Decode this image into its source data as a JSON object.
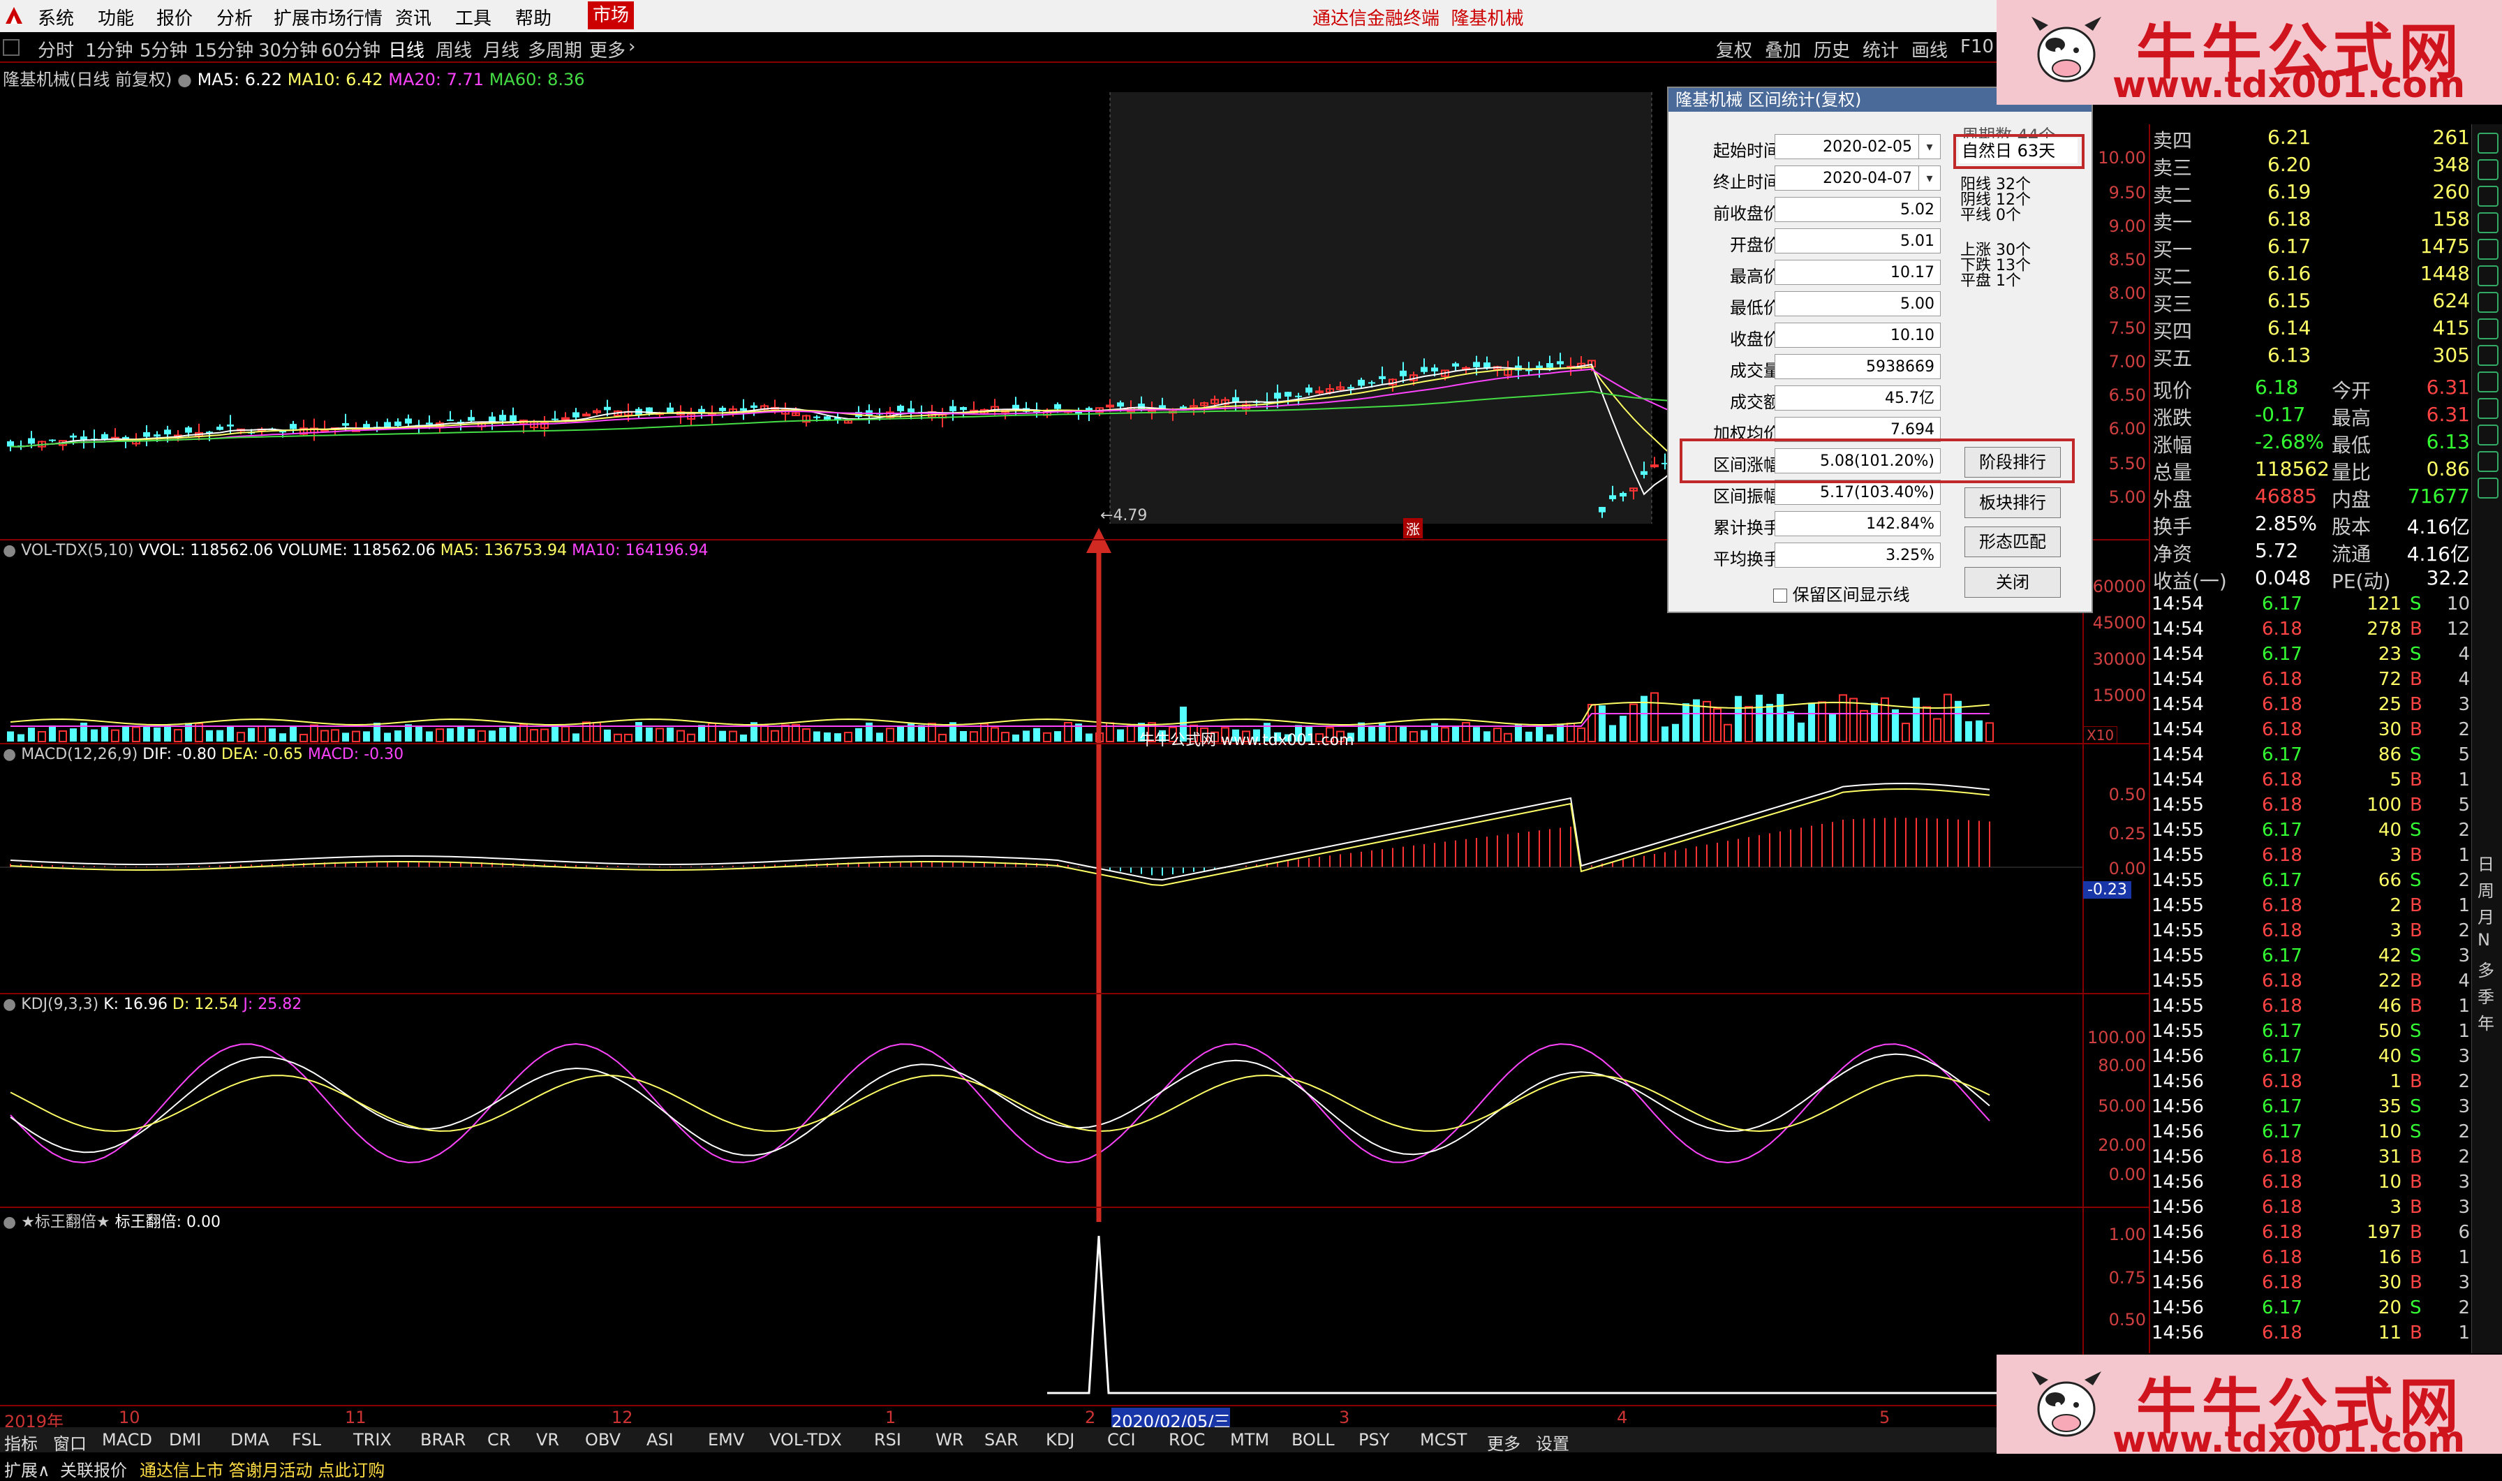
{
  "menubar": {
    "items": [
      "系统",
      "功能",
      "报价",
      "分析",
      "扩展市场行情",
      "资讯",
      "工具",
      "帮助"
    ],
    "market_tab": "市场",
    "title": "通达信金融终端",
    "stock": "隆基机械"
  },
  "periods": [
    "分时",
    "1分钟",
    "5分钟",
    "15分钟",
    "30分钟",
    "60分钟",
    "日线",
    "周线",
    "月线",
    "多周期",
    "更多"
  ],
  "selected_period": "日线",
  "right_buttons": [
    "复权",
    "叠加",
    "历史",
    "统计",
    "画线",
    "F10"
  ],
  "main_panel": {
    "title": "隆基机械(日线 前复权)",
    "ma_labels": [
      {
        "text": "MA5: 6.22",
        "color": "#ffffff"
      },
      {
        "text": "MA10: 6.42",
        "color": "#ffff66"
      },
      {
        "text": "MA20: 7.71",
        "color": "#ff44ff"
      },
      {
        "text": "MA60: 8.36",
        "color": "#44dd44"
      }
    ],
    "y_ticks": [
      "10.00",
      "9.50",
      "9.00",
      "8.50",
      "8.00",
      "7.50",
      "7.00",
      "6.50",
      "6.00",
      "5.50",
      "5.00"
    ],
    "low_marker": "4.79",
    "zhang_label": "涨"
  },
  "vol_panel": {
    "title": "VOL-TDX(5,10)",
    "labels": [
      {
        "text": "VVOL: 118562.06",
        "color": "#ffffff"
      },
      {
        "text": "VOLUME: 118562.06",
        "color": "#ffffff"
      },
      {
        "text": "MA5: 136753.94",
        "color": "#ffff66"
      },
      {
        "text": "MA10: 164196.94",
        "color": "#ff44ff"
      }
    ],
    "y_ticks": [
      "60000",
      "45000",
      "30000",
      "15000"
    ],
    "unit": "X10"
  },
  "macd_panel": {
    "title": "MACD(12,26,9)",
    "labels": [
      {
        "text": "DIF: -0.80",
        "color": "#ffffff"
      },
      {
        "text": "DEA: -0.65",
        "color": "#ffff66"
      },
      {
        "text": "MACD: -0.30",
        "color": "#ff44ff"
      }
    ],
    "y_ticks": [
      "0.50",
      "0.25",
      "0.00"
    ],
    "current": "-0.23"
  },
  "kdj_panel": {
    "title": "KDJ(9,3,3)",
    "labels": [
      {
        "text": "K: 16.96",
        "color": "#ffffff"
      },
      {
        "text": "D: 12.54",
        "color": "#ffff66"
      },
      {
        "text": "J: 25.82",
        "color": "#ff44ff"
      }
    ],
    "y_ticks": [
      "100.00",
      "80.00",
      "50.00",
      "20.00",
      "0.00"
    ]
  },
  "custom_panel": {
    "title": "★标王翻倍★",
    "label": "标王翻倍: 0.00",
    "y_ticks": [
      "1.00",
      "0.75",
      "0.50"
    ]
  },
  "watermark": "牛牛公式网 www.tdx001.com",
  "date_axis": [
    "2019年",
    "10",
    "11",
    "12",
    "1",
    "2",
    "2020/02/05/三",
    "3",
    "4",
    "5"
  ],
  "indicator_tabs": [
    "指标",
    "窗口",
    "MACD",
    "DMI",
    "DMA",
    "FSL",
    "TRIX",
    "BRAR",
    "CR",
    "VR",
    "OBV",
    "ASI",
    "EMV",
    "VOL-TDX",
    "RSI",
    "WR",
    "SAR",
    "KDJ",
    "CCI",
    "ROC",
    "MTM",
    "BOLL",
    "PSY",
    "MCST",
    "更多",
    "设置"
  ],
  "statusbar": {
    "expand": "扩展∧",
    "quote": "关联报价",
    "ticker": "通达信上市 答谢月活动 点此订购"
  },
  "dialog": {
    "title": "隆基机械 区间统计(复权)",
    "fields": [
      {
        "label": "起始时间",
        "value": "2020-02-05",
        "dropdown": true
      },
      {
        "label": "终止时间",
        "value": "2020-04-07",
        "dropdown": true
      },
      {
        "label": "前收盘价",
        "value": "5.02"
      },
      {
        "label": "开盘价",
        "value": "5.01"
      },
      {
        "label": "最高价",
        "value": "10.17"
      },
      {
        "label": "最低价",
        "value": "5.00"
      },
      {
        "label": "收盘价",
        "value": "10.10"
      },
      {
        "label": "成交量",
        "value": "5938669"
      },
      {
        "label": "成交额",
        "value": "45.7亿"
      },
      {
        "label": "加权均价",
        "value": "7.694"
      },
      {
        "label": "区间涨幅",
        "value": "5.08(101.20%)"
      },
      {
        "label": "区间振幅",
        "value": "5.17(103.40%)"
      },
      {
        "label": "累计换手",
        "value": "142.84%"
      },
      {
        "label": "平均换手",
        "value": "3.25%"
      }
    ],
    "period_label": "周期数",
    "period_value": "44个",
    "natural_days": "自然日 63天",
    "candle_stats": [
      "阳线 32个",
      "阴线 12个",
      "平线 0个"
    ],
    "move_stats": [
      "上涨 30个",
      "下跌 13个",
      "平盘 1个"
    ],
    "buttons": [
      "阶段排行",
      "板块排行",
      "形态匹配",
      "关闭"
    ],
    "checkbox_label": "保留区间显示线"
  },
  "quote": {
    "orderbook": [
      {
        "side": "卖四",
        "price": "6.21",
        "vol": "261"
      },
      {
        "side": "卖三",
        "price": "6.20",
        "vol": "348"
      },
      {
        "side": "卖二",
        "price": "6.19",
        "vol": "260"
      },
      {
        "side": "卖一",
        "price": "6.18",
        "vol": "158"
      },
      {
        "side": "买一",
        "price": "6.17",
        "vol": "1475"
      },
      {
        "side": "买二",
        "price": "6.16",
        "vol": "1448"
      },
      {
        "side": "买三",
        "price": "6.15",
        "vol": "624"
      },
      {
        "side": "买四",
        "price": "6.14",
        "vol": "415"
      },
      {
        "side": "买五",
        "price": "6.13",
        "vol": "305"
      }
    ],
    "stats": [
      {
        "l1": "现价",
        "v1": "6.18",
        "l2": "今开",
        "v2": "6.31",
        "c1": "#33ff33",
        "c2": "#ff4444"
      },
      {
        "l1": "涨跌",
        "v1": "-0.17",
        "l2": "最高",
        "v2": "6.31",
        "c1": "#33ff33",
        "c2": "#ff4444"
      },
      {
        "l1": "涨幅",
        "v1": "-2.68%",
        "l2": "最低",
        "v2": "6.13",
        "c1": "#33ff33",
        "c2": "#33ff33"
      },
      {
        "l1": "总量",
        "v1": "118562",
        "l2": "量比",
        "v2": "0.86",
        "c1": "#ffff66",
        "c2": "#ffff66"
      },
      {
        "l1": "外盘",
        "v1": "46885",
        "l2": "内盘",
        "v2": "71677",
        "c1": "#ff4444",
        "c2": "#33ff33"
      },
      {
        "l1": "换手",
        "v1": "2.85%",
        "l2": "股本",
        "v2": "4.16亿",
        "c1": "#ffffff",
        "c2": "#ffffff"
      },
      {
        "l1": "净资",
        "v1": "5.72",
        "l2": "流通",
        "v2": "4.16亿",
        "c1": "#ffffff",
        "c2": "#ffffff"
      },
      {
        "l1": "收益(一)",
        "v1": "0.048",
        "l2": "PE(动)",
        "v2": "32.2",
        "c1": "#ffffff",
        "c2": "#ffffff"
      }
    ],
    "ticks": [
      [
        "14:54",
        "6.17",
        "121",
        "S",
        "10"
      ],
      [
        "14:54",
        "6.18",
        "278",
        "B",
        "12"
      ],
      [
        "14:54",
        "6.17",
        "23",
        "S",
        "4"
      ],
      [
        "14:54",
        "6.18",
        "72",
        "B",
        "4"
      ],
      [
        "14:54",
        "6.18",
        "25",
        "B",
        "3"
      ],
      [
        "14:54",
        "6.18",
        "30",
        "B",
        "2"
      ],
      [
        "14:54",
        "6.17",
        "86",
        "S",
        "5"
      ],
      [
        "14:54",
        "6.18",
        "5",
        "B",
        "1"
      ],
      [
        "14:55",
        "6.18",
        "100",
        "B",
        "5"
      ],
      [
        "14:55",
        "6.17",
        "40",
        "S",
        "2"
      ],
      [
        "14:55",
        "6.18",
        "3",
        "B",
        "1"
      ],
      [
        "14:55",
        "6.17",
        "66",
        "S",
        "2"
      ],
      [
        "14:55",
        "6.18",
        "2",
        "B",
        "1"
      ],
      [
        "14:55",
        "6.18",
        "3",
        "B",
        "2"
      ],
      [
        "14:55",
        "6.17",
        "42",
        "S",
        "3"
      ],
      [
        "14:55",
        "6.18",
        "22",
        "B",
        "4"
      ],
      [
        "14:55",
        "6.18",
        "46",
        "B",
        "1"
      ],
      [
        "14:55",
        "6.17",
        "50",
        "S",
        "1"
      ],
      [
        "14:56",
        "6.17",
        "40",
        "S",
        "3"
      ],
      [
        "14:56",
        "6.18",
        "1",
        "B",
        "2"
      ],
      [
        "14:56",
        "6.17",
        "35",
        "S",
        "3"
      ],
      [
        "14:56",
        "6.17",
        "10",
        "S",
        "2"
      ],
      [
        "14:56",
        "6.18",
        "31",
        "B",
        "2"
      ],
      [
        "14:56",
        "6.18",
        "10",
        "B",
        "3"
      ],
      [
        "14:56",
        "6.18",
        "3",
        "B",
        "3"
      ],
      [
        "14:56",
        "6.18",
        "197",
        "B",
        "6"
      ],
      [
        "14:56",
        "6.18",
        "16",
        "B",
        "1"
      ],
      [
        "14:56",
        "6.18",
        "30",
        "B",
        "3"
      ],
      [
        "14:56",
        "6.17",
        "20",
        "S",
        "2"
      ],
      [
        "14:56",
        "6.18",
        "11",
        "B",
        "1"
      ]
    ]
  },
  "sidebar_right": [
    "日",
    "周",
    "月",
    "N",
    "多",
    "季",
    "年"
  ]
}
